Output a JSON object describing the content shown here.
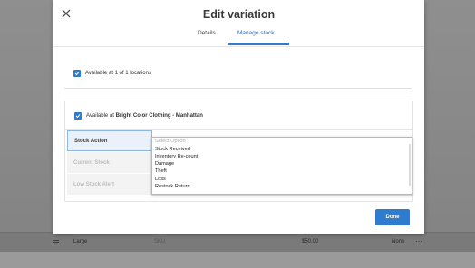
{
  "modal": {
    "title": "Edit variation",
    "tabs": [
      {
        "label": "Details",
        "active": false
      },
      {
        "label": "Manage stock",
        "active": true
      }
    ]
  },
  "availability": {
    "all_locations_label": "Available at 1 of 1 locations",
    "all_locations_checked": true,
    "location_prefix": "Available at ",
    "location_name": "Bright Color Clothing - Manhattan",
    "location_checked": true
  },
  "stock_fields": [
    {
      "label": "Stock Action",
      "state": "active"
    },
    {
      "label": "Current Stock",
      "state": "disabled"
    },
    {
      "label": "Low Stock Alert",
      "state": "disabled"
    }
  ],
  "stock_action_dropdown": {
    "placeholder": "Select Option",
    "options": [
      "Stock Received",
      "Inventory Re-count",
      "Damage",
      "Theft",
      "Loss",
      "Restock Return"
    ]
  },
  "footer": {
    "done_label": "Done"
  },
  "background_row": {
    "name": "Large",
    "sku": "SKU",
    "price": "$50.00",
    "stock": "None"
  },
  "colors": {
    "accent": "#2f7ccf",
    "active_field_bg": "#eaf1fa"
  },
  "icons": {
    "close": "close-icon",
    "checkbox": "check-icon",
    "drag": "drag-handle-icon",
    "more": "more-icon"
  }
}
